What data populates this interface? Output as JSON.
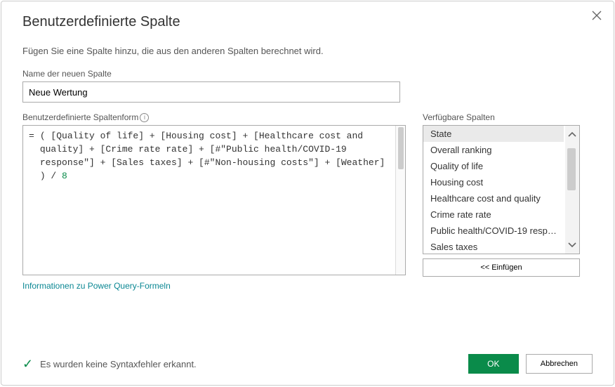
{
  "dialog": {
    "title": "Benutzerdefinierte Spalte",
    "subtitle": "Fügen Sie eine Spalte hinzu, die aus den anderen Spalten berechnet wird."
  },
  "newColumn": {
    "label": "Name der neuen Spalte",
    "value": "Neue Wertung"
  },
  "formula": {
    "label": "Benutzerdefinierte Spaltenform",
    "eq_sign": "=",
    "body": "( [Quality of life] + [Housing cost] + [Healthcare cost and quality] + [Crime rate rate] + [#\"Public health/COVID-19 response\"] + [Sales taxes] + [#\"Non-housing costs\"] + [Weather] ) / ",
    "divisor": "8"
  },
  "available": {
    "label": "Verfügbare Spalten",
    "items": [
      "State",
      "Overall ranking",
      "Quality of life",
      "Housing cost",
      "Healthcare cost and quality",
      "Crime rate rate",
      "Public health/COVID-19 respo...",
      "Sales taxes"
    ],
    "insert_label": "Einfügen",
    "insert_prefix": "<<"
  },
  "link": "Informationen zu Power Query-Formeln",
  "status": {
    "text": "Es wurden keine Syntaxfehler erkannt."
  },
  "buttons": {
    "ok": "OK",
    "cancel": "Abbrechen"
  }
}
